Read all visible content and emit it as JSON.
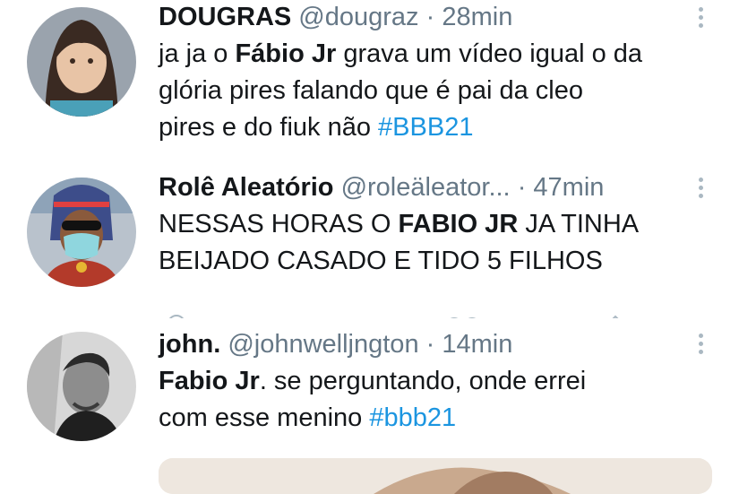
{
  "tweets": [
    {
      "name": "DOUGRAS",
      "handle": "@dougraz",
      "separator": "·",
      "time": "28min",
      "text": {
        "t1": "ja ja o ",
        "b1": "Fábio Jr",
        "t2": " grava um vídeo igual o da",
        "t3": "glória pires falando que é pai da cleo",
        "t4": "pires e do fiuk não ",
        "hashtag": "#BBB21"
      }
    },
    {
      "name": "Rolê Aleatório",
      "handle": "@roleäleator...",
      "separator": "·",
      "time": "47min",
      "text": {
        "t1": "NESSAS HORAS O ",
        "b1": "FABIO JR",
        "t2": " JA TINHA",
        "t3": "BEIJADO CASADO E TIDO 5 FILHOS"
      }
    },
    {
      "name": "john.",
      "handle": "@johnwelljngton",
      "separator": "·",
      "time": "14min",
      "text": {
        "b1": "Fabio Jr",
        "t1": ". se perguntando, onde errei",
        "t2": "com esse menino ",
        "hashtag": "#bbb21"
      }
    }
  ],
  "icons": {
    "more": "more-vertical-icon",
    "avatar": "avatar-image"
  },
  "colors": {
    "text": "#14171a",
    "secondary": "#657786",
    "hashtag": "#1b95e0",
    "more_dots": "#aab8c2"
  }
}
